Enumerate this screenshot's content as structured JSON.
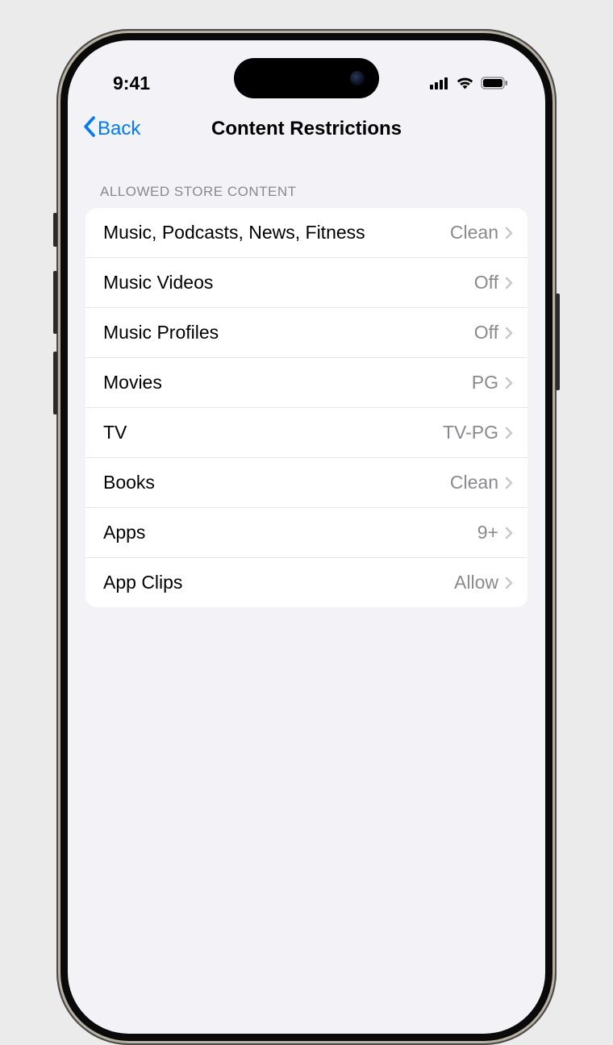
{
  "status": {
    "time": "9:41"
  },
  "nav": {
    "back_label": "Back",
    "title": "Content Restrictions"
  },
  "section": {
    "header": "Allowed Store Content",
    "rows": [
      {
        "label": "Music, Podcasts, News, Fitness",
        "value": "Clean"
      },
      {
        "label": "Music Videos",
        "value": "Off"
      },
      {
        "label": "Music Profiles",
        "value": "Off"
      },
      {
        "label": "Movies",
        "value": "PG"
      },
      {
        "label": "TV",
        "value": "TV-PG"
      },
      {
        "label": "Books",
        "value": "Clean"
      },
      {
        "label": "Apps",
        "value": "9+"
      },
      {
        "label": "App Clips",
        "value": "Allow"
      }
    ]
  }
}
